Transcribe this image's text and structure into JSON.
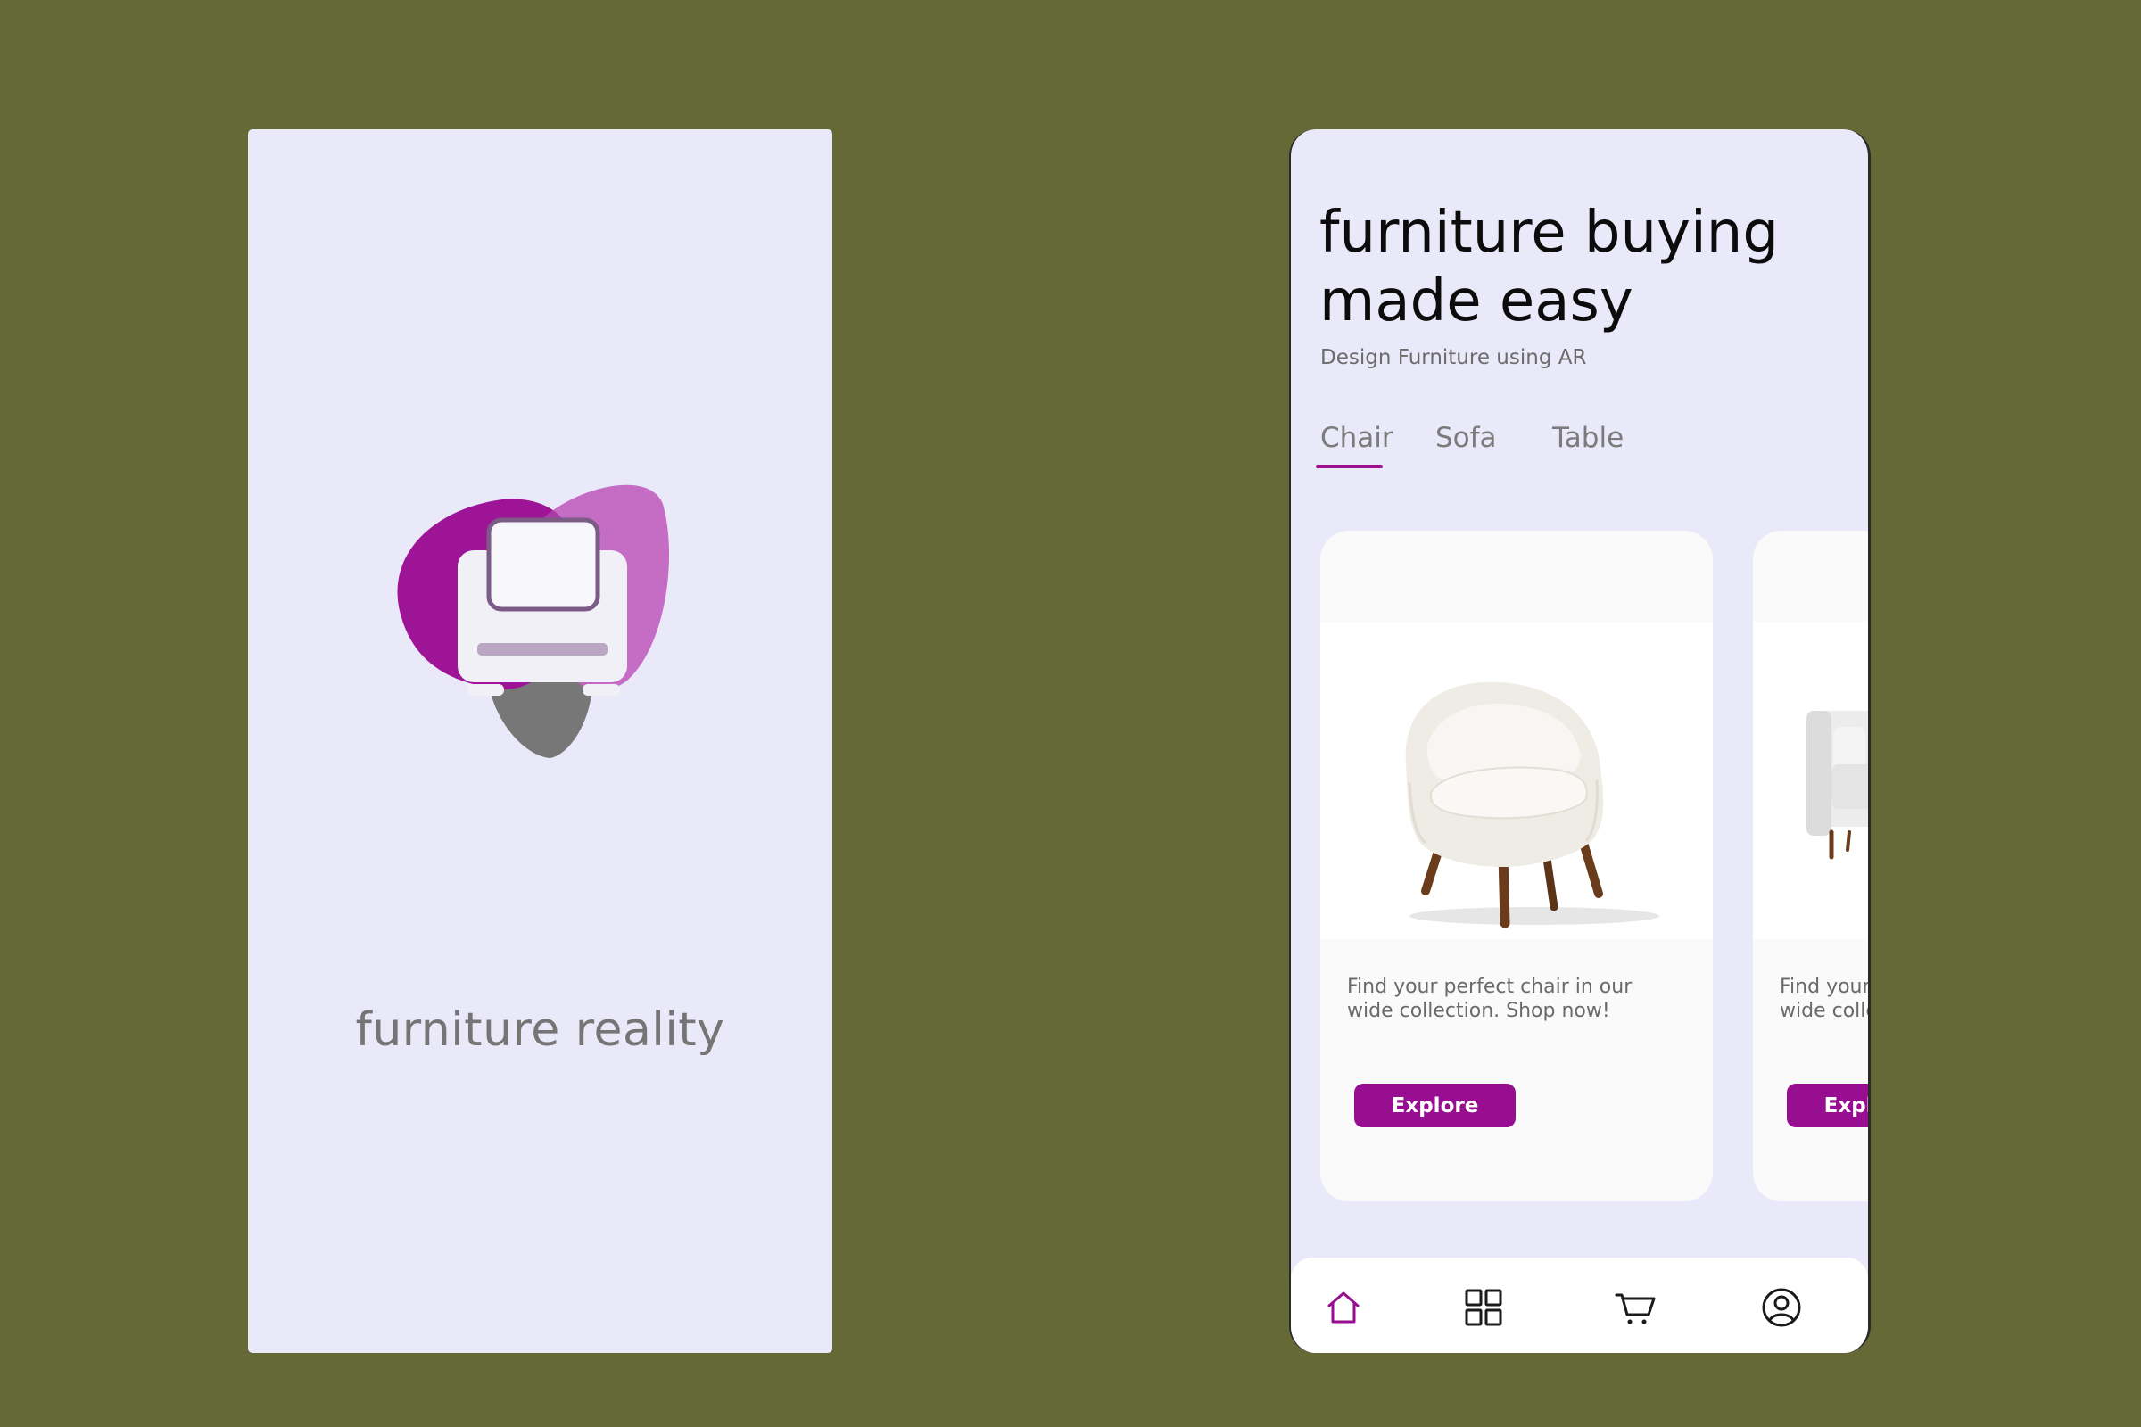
{
  "splash": {
    "brand_name": "furniture reality",
    "logo_icon": "sofa-blob-logo"
  },
  "home": {
    "headline": "furniture buying made easy",
    "subtitle": "Design Furniture using AR",
    "tabs": [
      {
        "label": "Chair",
        "active": true
      },
      {
        "label": "Sofa",
        "active": false
      },
      {
        "label": "Table",
        "active": false
      }
    ],
    "cards": [
      {
        "image": "white-armchair-image",
        "text": "Find your perfect chair in our wide collection. Shop now!",
        "button": "Explore"
      },
      {
        "image": "grey-sofa-image",
        "text": "Find your perfect chair in our wide collection. Shop now!",
        "button": "Explore"
      }
    ],
    "bottom_nav": [
      {
        "icon": "home-icon",
        "active": true
      },
      {
        "icon": "grid-icon",
        "active": false
      },
      {
        "icon": "cart-icon",
        "active": false
      },
      {
        "icon": "profile-icon",
        "active": false
      }
    ]
  },
  "colors": {
    "background": "#646936",
    "screen": "#e9e9f9",
    "accent": "#980e91",
    "logo_purple": "#9e1496",
    "logo_pink": "#c366c1",
    "logo_grey": "#777777"
  }
}
